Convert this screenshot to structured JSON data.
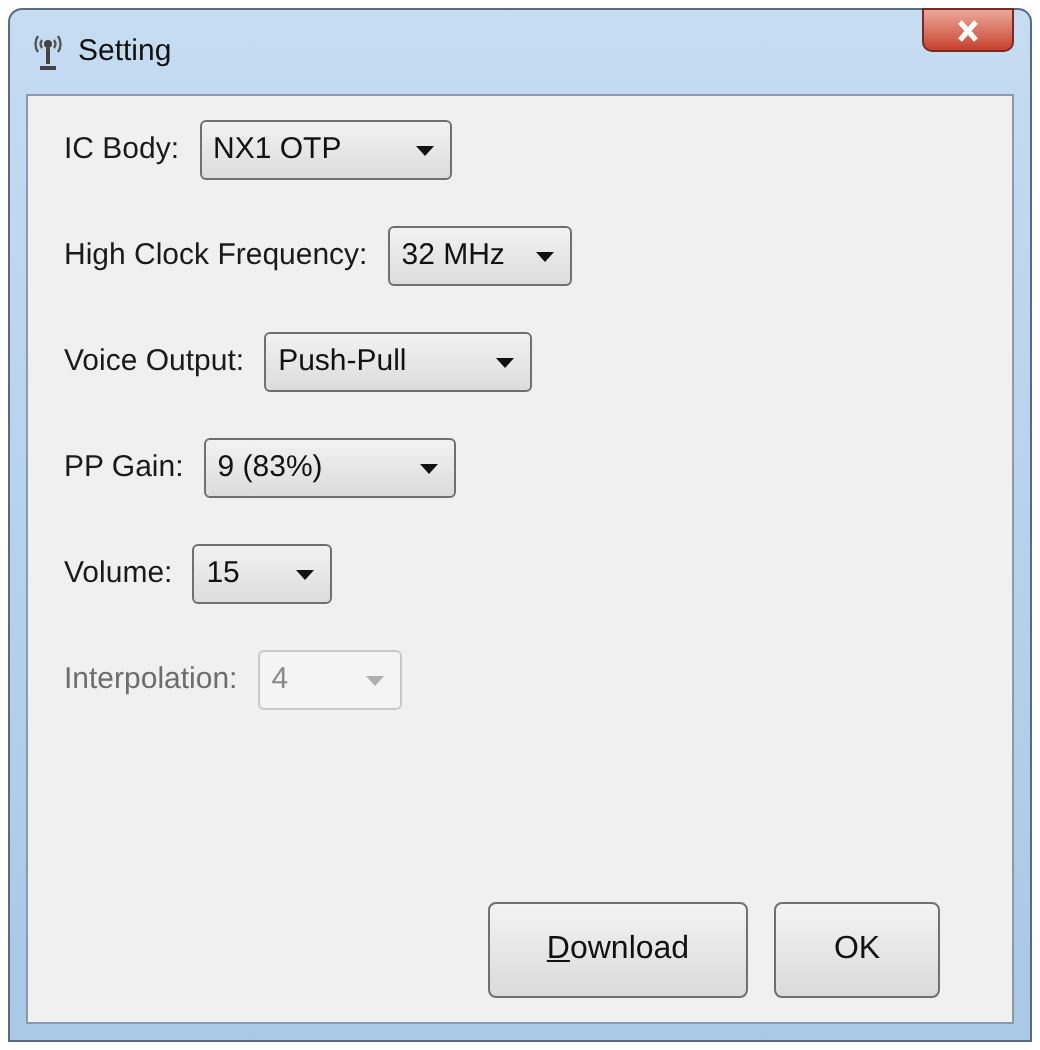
{
  "window": {
    "title": "Setting"
  },
  "fields": [
    {
      "label": "IC Body:",
      "value": "NX1 OTP",
      "disabled": false
    },
    {
      "label": "High Clock Frequency:",
      "value": "32 MHz",
      "disabled": false
    },
    {
      "label": "Voice Output:",
      "value": "Push-Pull",
      "disabled": false
    },
    {
      "label": "PP Gain:",
      "value": "9 (83%)",
      "disabled": false
    },
    {
      "label": "Volume:",
      "value": "15",
      "disabled": false
    },
    {
      "label": "Interpolation:",
      "value": "4",
      "disabled": true
    }
  ],
  "buttons": [
    {
      "label": "Download",
      "mnemonic_first": true
    },
    {
      "label": "OK",
      "mnemonic_first": false
    }
  ]
}
